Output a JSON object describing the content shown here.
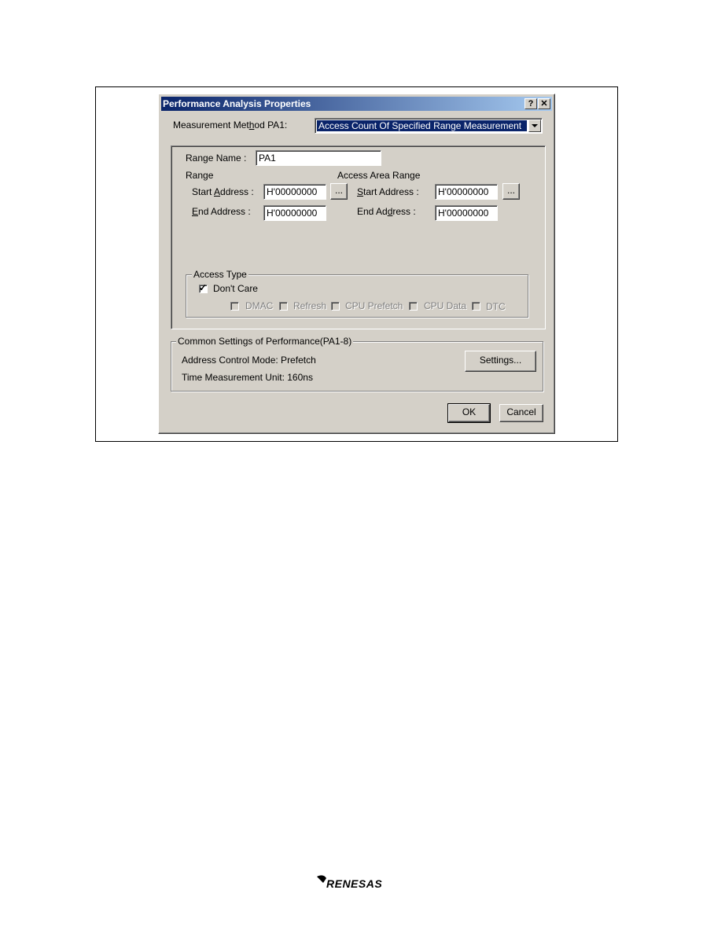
{
  "dialog": {
    "title": "Performance Analysis Properties",
    "help_button": "?",
    "close_button": "✕"
  },
  "measurement": {
    "label_pre": "Measurement Met",
    "label_u": "h",
    "label_post": "od PA1:",
    "selected": "Access Count Of Specified Range Measurement"
  },
  "range_name": {
    "label": "Range Name :",
    "value": "PA1"
  },
  "range": {
    "heading": "Range",
    "start_label_pre": "Start ",
    "start_label_u": "A",
    "start_label_post": "ddress :",
    "start_value": "H'00000000",
    "browse": "...",
    "end_label_u": "E",
    "end_label_post": "nd Address :",
    "end_value": "H'00000000"
  },
  "access_area": {
    "heading": "Access Area Range",
    "start_label_u": "S",
    "start_label_post": "tart Address :",
    "start_value": "H'00000000",
    "browse": "...",
    "end_label_pre": "End Ad",
    "end_label_u": "d",
    "end_label_post": "ress :",
    "end_value": "H'00000000"
  },
  "access_type": {
    "legend": "Access Type",
    "dont_care_label": "Don't Care",
    "dont_care_checked": true,
    "dmac": "DMAC",
    "refresh": "Refresh",
    "cpu_prefetch": "CPU Prefetch",
    "cpu_data": "CPU Data",
    "dtc": "DTC"
  },
  "common": {
    "legend": "Common Settings of Performance(PA1-8)",
    "address_control": "Address Control Mode: Prefetch",
    "time_unit": "Time Measurement Unit: 160ns",
    "settings_button": "Settings..."
  },
  "buttons": {
    "ok": "OK",
    "cancel": "Cancel"
  },
  "footer": {
    "logo_text": "RENESAS"
  }
}
